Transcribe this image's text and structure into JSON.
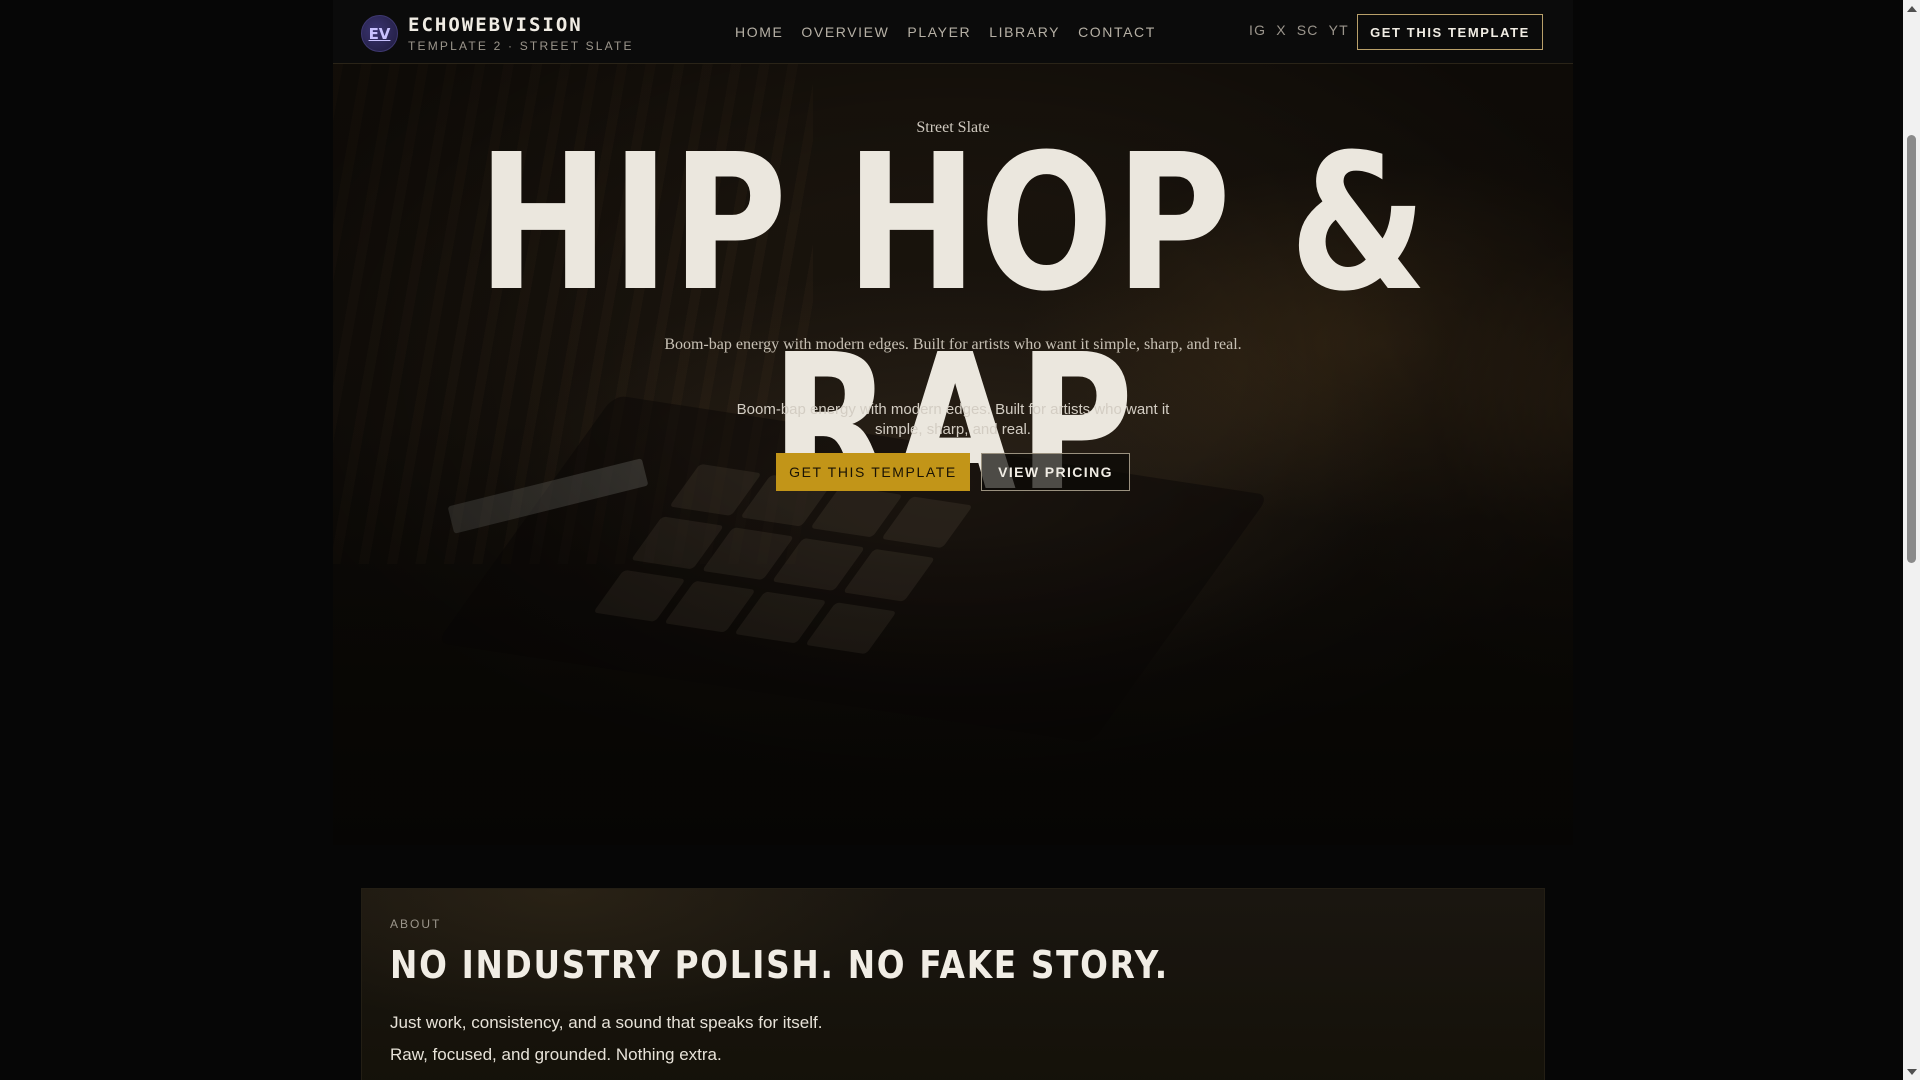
{
  "header": {
    "logo_initials": "EV",
    "brand_name": "ECHOWEBVISION",
    "brand_sub": "TEMPLATE 2 · STREET SLATE",
    "nav": [
      "HOME",
      "OVERVIEW",
      "PLAYER",
      "LIBRARY",
      "CONTACT"
    ],
    "social": [
      "IG",
      "X",
      "SC",
      "YT"
    ],
    "cta_label": "GET THIS TEMPLATE"
  },
  "hero": {
    "eyebrow": "Street Slate",
    "title": "HIP HOP & RAP",
    "tagline": "Boom-bap energy with modern edges. Built for artists who want it simple, sharp, and real.",
    "lead": "Boom-bap energy with modern edges. Built for artists who want it simple, sharp, and real.",
    "primary_button": "GET THIS TEMPLATE",
    "secondary_button": "VIEW PRICING"
  },
  "about": {
    "eyebrow": "ABOUT",
    "title": "NO INDUSTRY POLISH. NO FAKE STORY.",
    "paragraph_1": "Just work, consistency, and a sound that speaks for itself.",
    "paragraph_2": "Raw, focused, and grounded. Nothing extra."
  },
  "colors": {
    "accent_gold": "#c29518",
    "background": "#060606",
    "text": "#ebe7de"
  }
}
